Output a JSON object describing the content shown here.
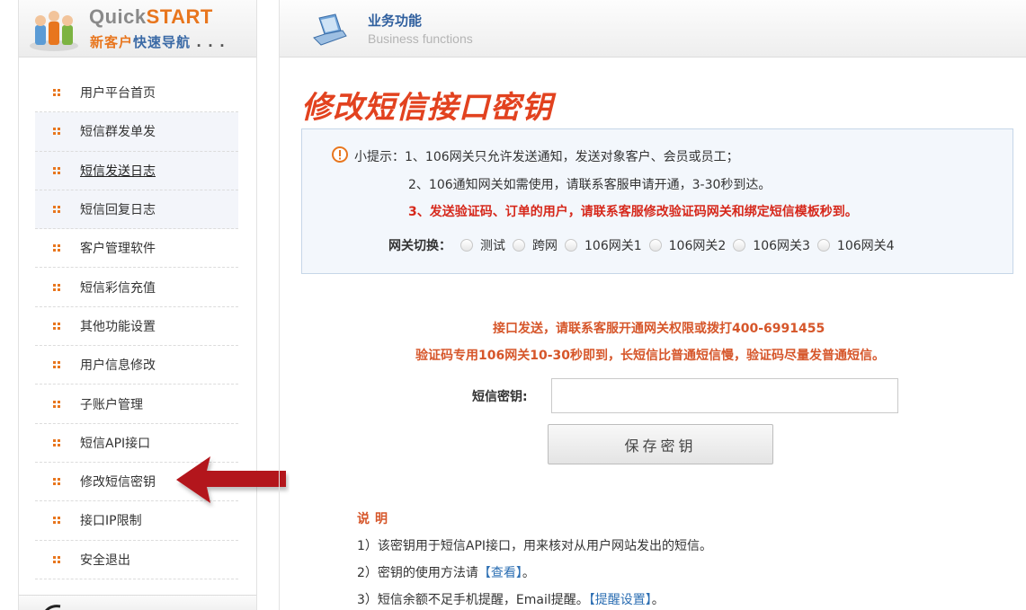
{
  "sidebar": {
    "brand_quick": "Quick",
    "brand_start": "START",
    "subtitle_a": "新客户",
    "subtitle_b": "快速导航",
    "subtitle_c": " . . .",
    "items": [
      {
        "label": "用户平台首页"
      },
      {
        "label": "短信群发单发"
      },
      {
        "label": "短信发送日志"
      },
      {
        "label": "短信回复日志"
      },
      {
        "label": "客户管理软件"
      },
      {
        "label": "短信彩信充值"
      },
      {
        "label": "其他功能设置"
      },
      {
        "label": "用户信息修改"
      },
      {
        "label": "子账户管理"
      },
      {
        "label": "短信API接口"
      },
      {
        "label": "修改短信密钥"
      },
      {
        "label": "接口IP限制"
      },
      {
        "label": "安全退出"
      }
    ]
  },
  "header": {
    "title": "业务功能",
    "subtitle": "Business functions"
  },
  "page_title": "修改短信接口密钥",
  "tips": {
    "line1": "小提示：1、106网关只允许发送通知，发送对象客户、会员或员工；",
    "line2": "2、106通知网关如需使用，请联系客服申请开通，3-30秒到达。",
    "line3": "3、发送验证码、订单的用户，请联系客服修改验证码网关和绑定短信模板秒到。",
    "gateway_label": "网关切换：",
    "gateway_options": [
      {
        "label": "测试"
      },
      {
        "label": "跨网"
      },
      {
        "label": "106网关1"
      },
      {
        "label": "106网关2"
      },
      {
        "label": "106网关3"
      },
      {
        "label": "106网关4"
      }
    ]
  },
  "notice": {
    "line1": "接口发送，请联系客服开通网关权限或拨打400-6991455",
    "line2": "验证码专用106网关10-30秒即到，长短信比普通短信慢，验证码尽量发普通短信。"
  },
  "form": {
    "key_label": "短信密钥:",
    "key_value": "",
    "save_label": "保存密钥"
  },
  "description": {
    "title": "说明",
    "line1": "1）该密钥用于短信API接口，用来核对从用户网站发出的短信。",
    "line2_prefix": "2）密钥的使用方法请",
    "line2_link": "【查看】",
    "line2_suffix": "。",
    "line3_prefix": "3）短信余额不足手机提醒，Email提醒。",
    "line3_link": "【提醒设置】",
    "line3_suffix": "。"
  },
  "colors": {
    "accent_orange": "#e8761e",
    "title_red": "#e2421f",
    "alert_red": "#d6281b",
    "link_blue": "#2d6fb3",
    "arrow_red": "#b3151b"
  }
}
